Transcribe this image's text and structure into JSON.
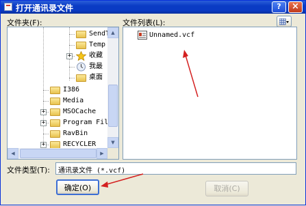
{
  "window": {
    "title": "打开通讯录文件",
    "help_label": "?",
    "close_label": "×"
  },
  "folder_label": "文件夹(F):",
  "file_list_label": "文件列表(L):",
  "view_menu_icon": "view-menu-icon",
  "folder_tree": [
    {
      "label": "SendT",
      "icon": "folder-icon"
    },
    {
      "label": "Temp",
      "icon": "folder-icon"
    },
    {
      "label": "收藏",
      "icon": "star-folder-icon"
    },
    {
      "label": "我最",
      "icon": "recent-icon"
    },
    {
      "label": "桌面",
      "icon": "folder-icon"
    },
    {
      "label": "I386",
      "icon": "folder-icon"
    },
    {
      "label": "Media",
      "icon": "folder-icon"
    },
    {
      "label": "MSOCache",
      "icon": "folder-icon"
    },
    {
      "label": "Program Fil",
      "icon": "folder-icon"
    },
    {
      "label": "RavBin",
      "icon": "folder-icon"
    },
    {
      "label": "RECYCLER",
      "icon": "folder-icon"
    }
  ],
  "files": [
    {
      "name": "Unnamed.vcf",
      "icon": "vcard-file-icon"
    }
  ],
  "file_type": {
    "label": "文件类型(T):",
    "value": "通讯录文件 (*.vcf)"
  },
  "buttons": {
    "ok": "确定(O)",
    "cancel": "取消(C)"
  },
  "colors": {
    "title_bar": "#0a3bc4",
    "annotation_arrow": "#d42020",
    "dialog_face": "#ece9d8"
  }
}
